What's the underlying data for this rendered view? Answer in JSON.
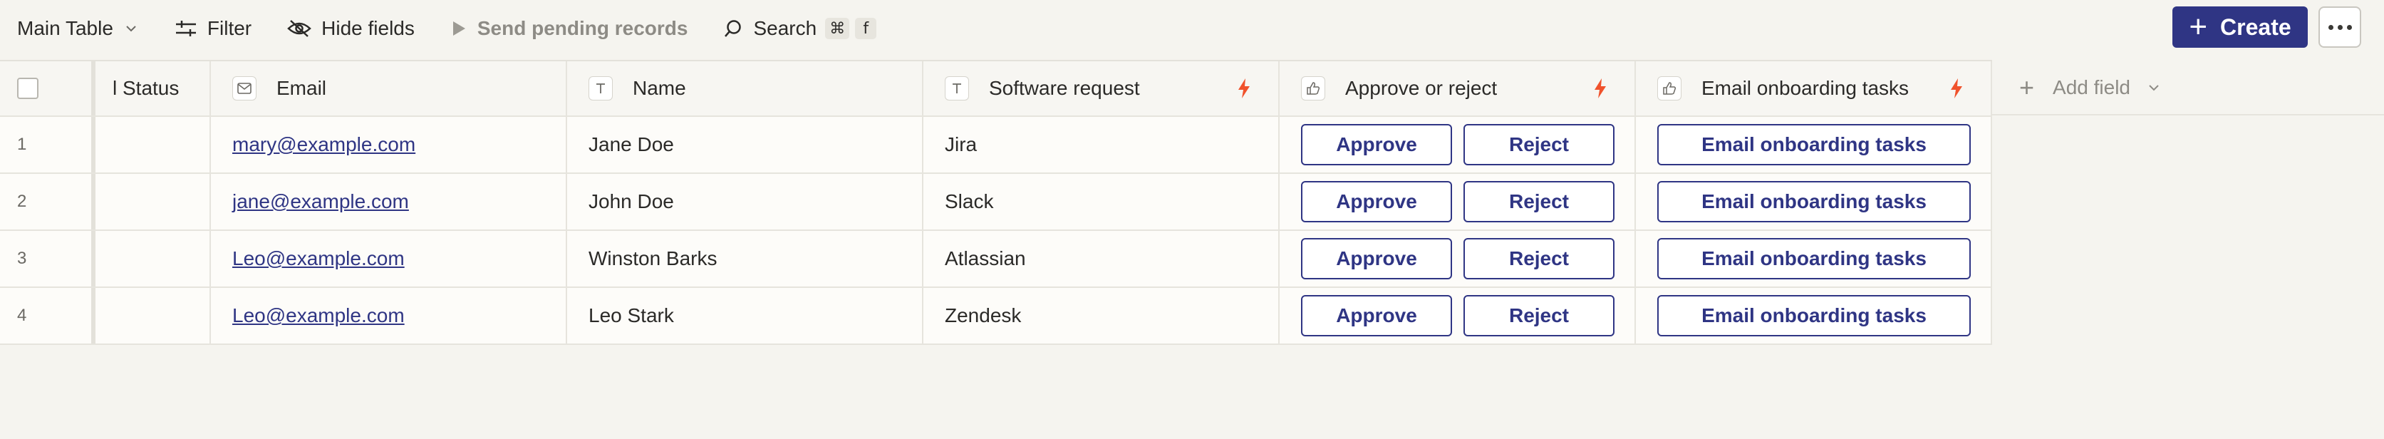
{
  "toolbar": {
    "table_label": "Main Table",
    "filter_label": "Filter",
    "hide_fields_label": "Hide fields",
    "send_pending_label": "Send pending records",
    "search_label": "Search",
    "search_kbd_1": "⌘",
    "search_kbd_2": "f",
    "create_label": "Create"
  },
  "columns": {
    "status": "l Status",
    "email": "Email",
    "name": "Name",
    "software": "Software request",
    "approve": "Approve or reject",
    "onboarding": "Email onboarding tasks",
    "add_field": "Add field"
  },
  "rows": [
    {
      "index": "1",
      "email": "mary@example.com",
      "name": "Jane Doe",
      "software": "Jira",
      "approve": "Approve",
      "reject": "Reject",
      "onboarding": "Email onboarding tasks"
    },
    {
      "index": "2",
      "email": "jane@example.com",
      "name": "John Doe",
      "software": "Slack",
      "approve": "Approve",
      "reject": "Reject",
      "onboarding": "Email onboarding tasks"
    },
    {
      "index": "3",
      "email": "Leo@example.com",
      "name": "Winston Barks",
      "software": "Atlassian",
      "approve": "Approve",
      "reject": "Reject",
      "onboarding": "Email onboarding tasks"
    },
    {
      "index": "4",
      "email": "Leo@example.com",
      "name": "Leo Stark",
      "software": "Zendesk",
      "approve": "Approve",
      "reject": "Reject",
      "onboarding": "Email onboarding tasks"
    }
  ],
  "colors": {
    "accent": "#2f3584",
    "bolt": "#f0522c",
    "background": "#f5f4ef"
  },
  "icons": {
    "email_column": "mail-icon",
    "text_column": "text-icon",
    "button_column": "thumbs-up-icon",
    "trigger": "lightning-bolt-icon"
  }
}
